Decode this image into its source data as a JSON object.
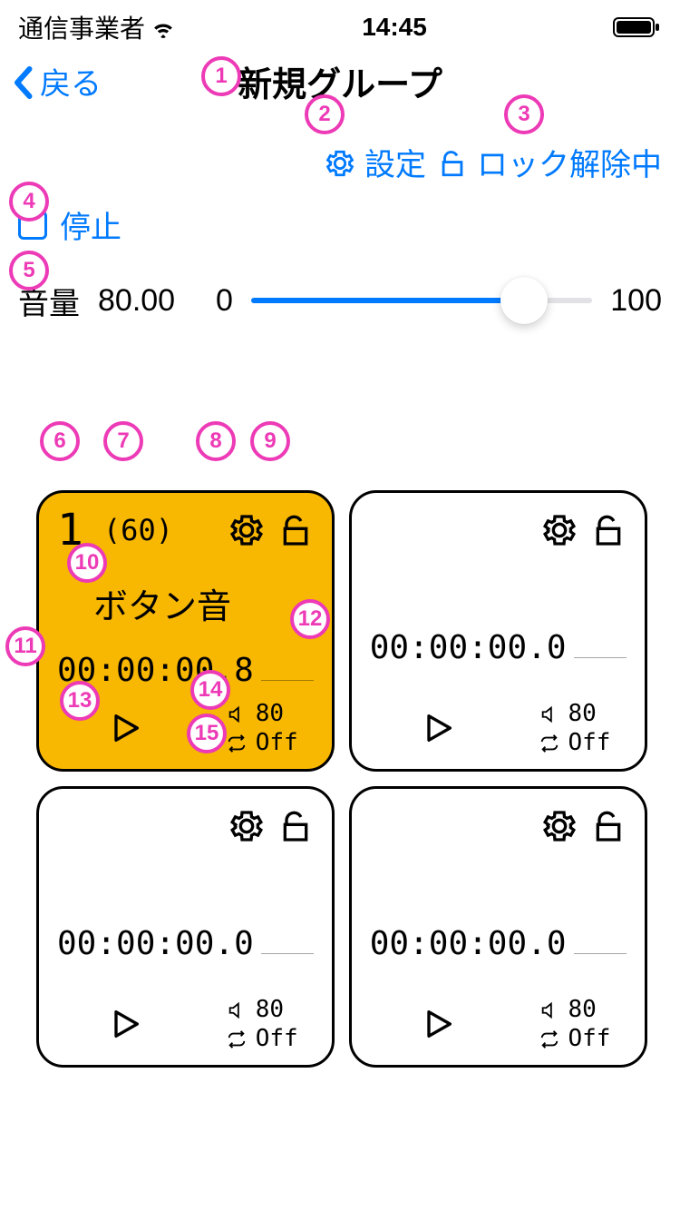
{
  "status": {
    "carrier": "通信事業者",
    "time": "14:45"
  },
  "nav": {
    "back": "戻る",
    "title": "新規グループ"
  },
  "toolbar": {
    "settings": "設定",
    "lock": "ロック解除中"
  },
  "stop": {
    "label": "停止"
  },
  "volume": {
    "label": "音量",
    "value": "80.00",
    "min": "0",
    "max": "100",
    "percent": 80
  },
  "cards": [
    {
      "index": "1",
      "bpm": "(60)",
      "name": "ボタン音",
      "time": "00:00:00.8",
      "dur": "",
      "vol": "80",
      "loop": "Off",
      "active": true
    },
    {
      "index": "",
      "bpm": "",
      "name": "",
      "time": "00:00:00.0",
      "dur": "",
      "vol": "80",
      "loop": "Off",
      "active": false
    },
    {
      "index": "",
      "bpm": "",
      "name": "",
      "time": "00:00:00.0",
      "dur": "",
      "vol": "80",
      "loop": "Off",
      "active": false
    },
    {
      "index": "",
      "bpm": "",
      "name": "",
      "time": "00:00:00.0",
      "dur": "",
      "vol": "80",
      "loop": "Off",
      "active": false
    }
  ],
  "badges": [
    "1",
    "2",
    "3",
    "4",
    "5",
    "6",
    "7",
    "8",
    "9",
    "10",
    "11",
    "12",
    "13",
    "14",
    "15"
  ]
}
